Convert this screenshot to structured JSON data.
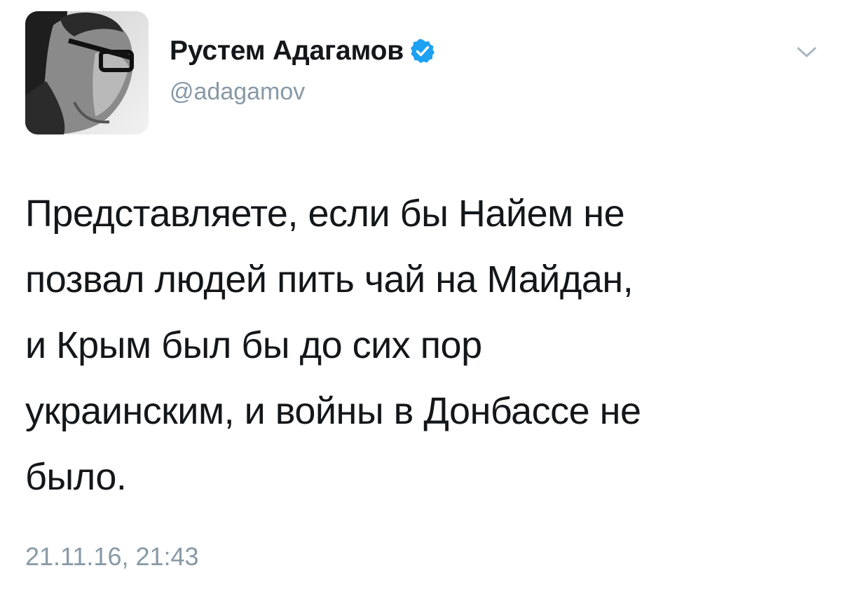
{
  "tweet": {
    "author": {
      "display_name": "Рустем Адагамов",
      "handle": "@adagamov",
      "verified": true,
      "avatar_icon": "avatar-photo"
    },
    "text": "Представляете, если бы Найем не\nпозвал людей пить чай на Майдан,\nи Крым был бы до сих пор\nукраинским, и войны в Донбассе не\nбыло.",
    "timestamp": "21.11.16, 21:43",
    "menu_icon": "chevron-down-icon"
  },
  "colors": {
    "primary_text": "#14171a",
    "secondary_text": "#8899a6",
    "verified_badge": "#1da1f2",
    "background": "#ffffff"
  }
}
